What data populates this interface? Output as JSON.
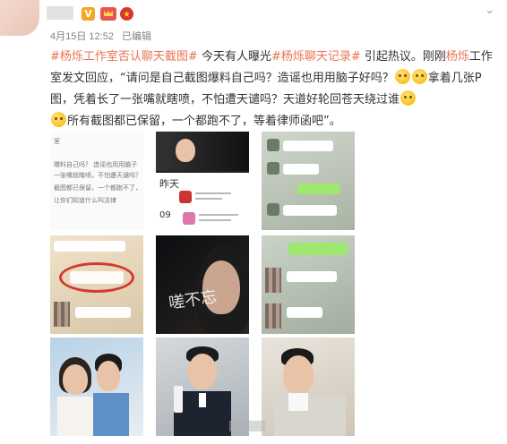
{
  "post": {
    "date": "4月15日 12:52",
    "edited": "已编辑",
    "verified_badge": "V",
    "accent_color": "#eb7350",
    "text": {
      "tag1": "#杨烁工作室否认聊天截图#",
      "part1": "今天有人曝光",
      "tag2": "#杨烁聊天记录#",
      "part2": "引起热议。刚刚",
      "mention": "杨烁",
      "part3": "工作室发文回应，“请问是自己截图爆料自己吗？造谣也用用脑子好吗？",
      "part4": "拿着几张P图，凭着长了一张嘴就瞎喷，不怕遭天谴吗？天道好轮回苍天绕过谁",
      "part5": "所有截图都已保留，一个都跑不了，等着律师函吧”。"
    }
  },
  "images": {
    "t1_lines": [
      "室",
      "爆料自己吗？ 造谣也用用脑子",
      "一张嘴就瞎喷，不怕遭天谴吗？",
      "截图都已保留，一个都跑不了，",
      "让你们知道什么叫法律"
    ],
    "t2_label": "昨天",
    "t2_num": "09",
    "t5_caption": "嗟不忘"
  },
  "icons": {
    "chevron": "chevron-down-icon",
    "emoji": "smile-emoji-icon"
  }
}
